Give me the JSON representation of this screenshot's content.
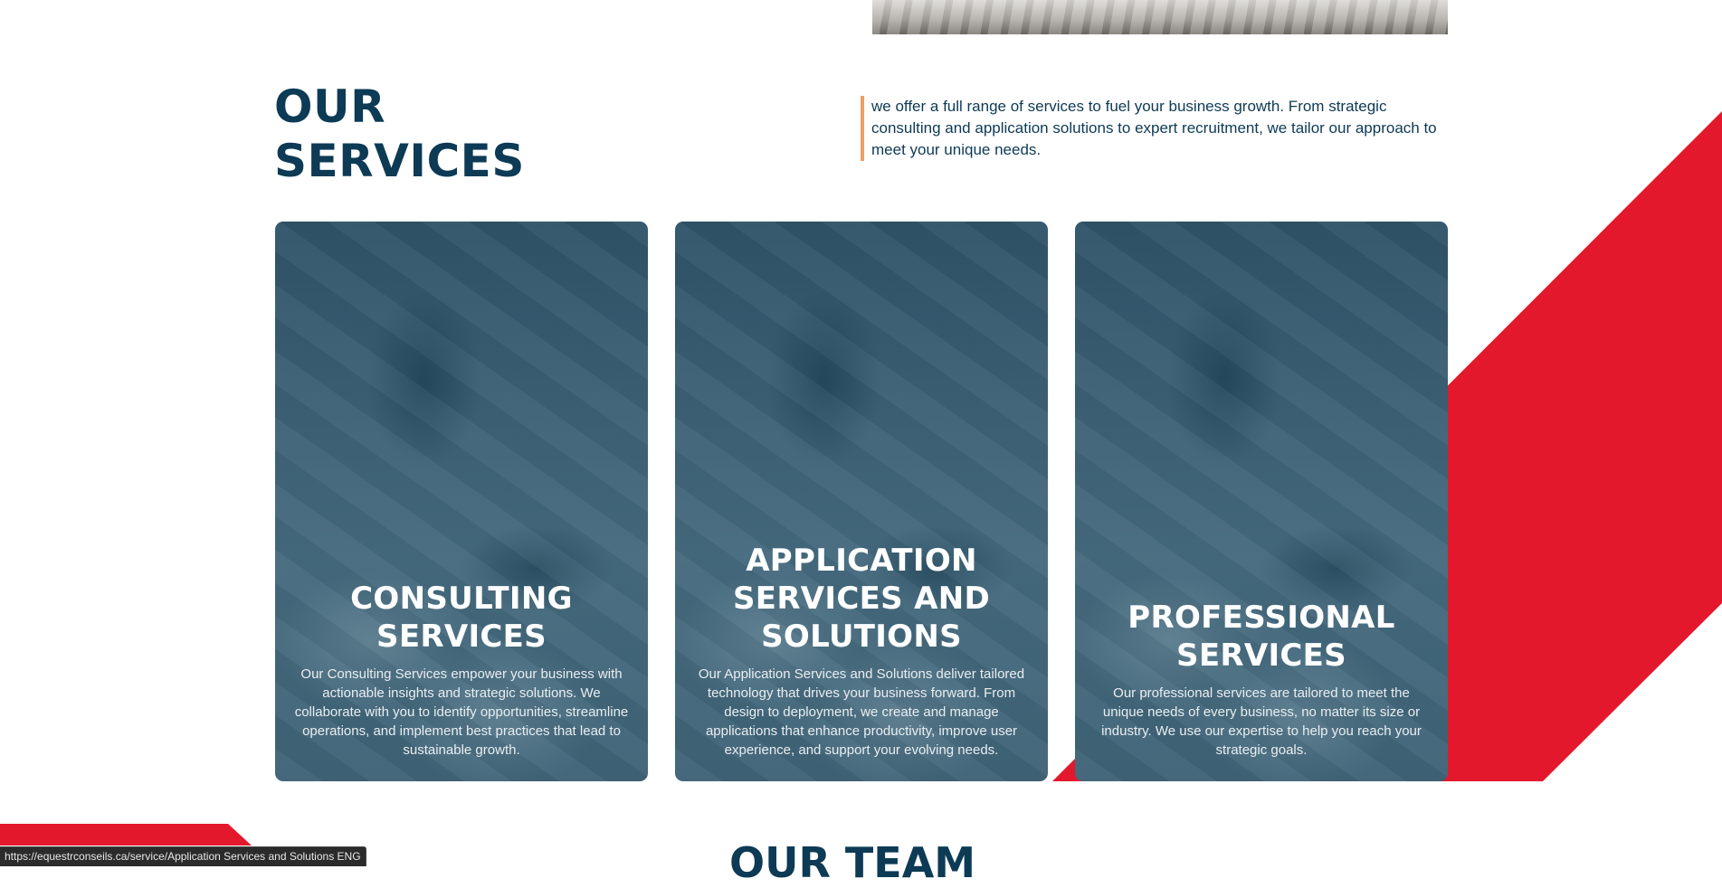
{
  "colors": {
    "navy": "#0d3a55",
    "accent_red": "#e3182d",
    "accent_orange": "#e8a06a"
  },
  "section": {
    "title_line1": "OUR",
    "title_line2": "SERVICES",
    "intro": "we offer a full range of services to fuel your business growth. From strategic consulting and application solutions to expert recruitment, we tailor our approach to meet your unique needs."
  },
  "cards": [
    {
      "title_line1": "CONSULTING",
      "title_line2": "SERVICES",
      "title_line3": "",
      "description": "Our Consulting Services empower your business with actionable insights and strategic solutions. We collaborate with you to identify opportunities, streamline operations, and implement best practices that lead to sustainable growth."
    },
    {
      "title_line1": "APPLICATION",
      "title_line2": "SERVICES AND",
      "title_line3": "SOLUTIONS",
      "description": "Our Application Services and Solutions deliver tailored technology that drives your business forward. From design to deployment, we create and manage applications that enhance productivity, improve user experience, and support your evolving needs."
    },
    {
      "title_line1": "PROFESSIONAL",
      "title_line2": "SERVICES",
      "title_line3": "",
      "description": "Our professional services are tailored to meet the unique needs of every business, no matter its size or industry. We use our expertise to help you reach your strategic goals."
    }
  ],
  "team": {
    "title": "OUR TEAM"
  },
  "status_bar": {
    "url": "https://equestrconseils.ca/service/Application Services and Solutions ENG"
  }
}
